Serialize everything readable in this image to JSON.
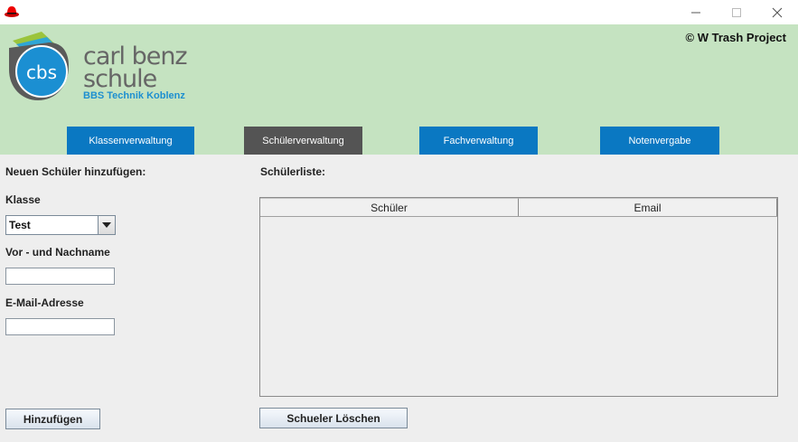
{
  "window": {
    "minimize": "—",
    "maximize": "☐",
    "close": "✕"
  },
  "header": {
    "logo_badge": "cbs",
    "logo_line1": "carl benz",
    "logo_line2": "schule",
    "logo_subtitle": "BBS Technik Koblenz",
    "copyright": "© W Trash Project"
  },
  "tabs": [
    {
      "label": "Klassenverwaltung",
      "active": false
    },
    {
      "label": "Schülerverwaltung",
      "active": true
    },
    {
      "label": "Fachverwaltung",
      "active": false
    },
    {
      "label": "Notenvergabe",
      "active": false
    }
  ],
  "form": {
    "title": "Neuen Schüler hinzufügen:",
    "klasse_label": "Klasse",
    "klasse_value": "Test",
    "name_label": "Vor - und Nachname",
    "name_value": "",
    "email_label": "E-Mail-Adresse",
    "email_value": "",
    "add_button": "Hinzufügen"
  },
  "list": {
    "title": "Schülerliste:",
    "columns": [
      "Schüler",
      "Email"
    ],
    "rows": [],
    "delete_button": "Schueler Löschen"
  },
  "colors": {
    "header_bg": "#c5e3c1",
    "tab_blue": "#0a78c2",
    "tab_active": "#545454",
    "logo_blue": "#1d8fd0"
  }
}
